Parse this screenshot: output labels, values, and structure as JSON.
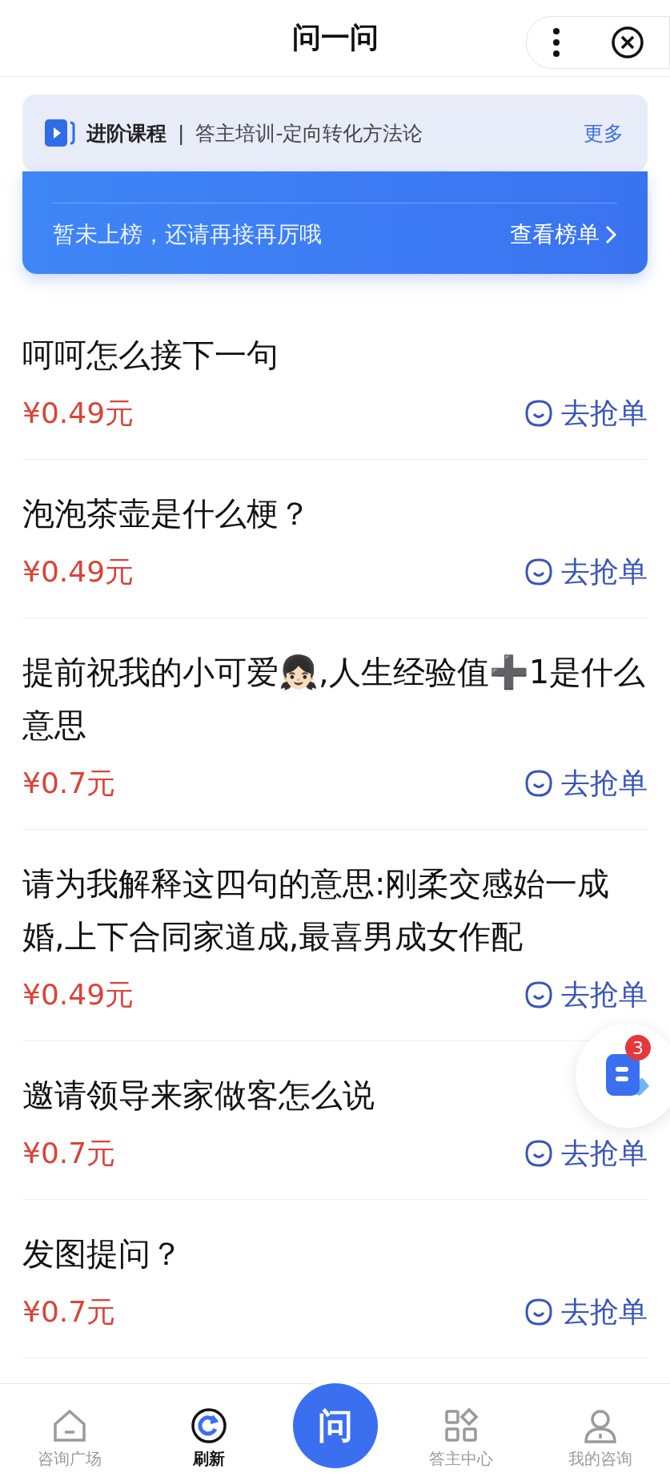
{
  "header": {
    "title": "问一问"
  },
  "course_bar": {
    "tag": "进阶课程",
    "separator": "|",
    "title": "答主培训-定向转化方法论",
    "more": "更多"
  },
  "rank_banner": {
    "message": "暂未上榜，还请再接再厉哦",
    "link": "查看榜单"
  },
  "questions": [
    {
      "text": "呵呵怎么接下一句",
      "price": "¥0.49元",
      "action": "去抢单"
    },
    {
      "text": "泡泡茶壶是什么梗？",
      "price": "¥0.49元",
      "action": "去抢单"
    },
    {
      "text": "提前祝我的小可爱👧🏻,人生经验值➕1是什么意思",
      "price": "¥0.7元",
      "action": "去抢单"
    },
    {
      "text": "请为我解释这四句的意思:刚柔交感始一成婚,上下合同家道成,最喜男成女作配",
      "price": "¥0.49元",
      "action": "去抢单"
    },
    {
      "text": "邀请领导来家做客怎么说",
      "price": "¥0.7元",
      "action": "去抢单"
    },
    {
      "text": "发图提问？",
      "price": "¥0.7元",
      "action": "去抢单"
    }
  ],
  "float_button": {
    "badge": "3"
  },
  "nav": [
    {
      "kind": "home",
      "label": "咨询广场",
      "selected": false
    },
    {
      "kind": "refresh",
      "label": "刷新",
      "selected": true
    },
    {
      "kind": "ask",
      "label": "问",
      "selected": false
    },
    {
      "kind": "grid",
      "label": "答主中心",
      "selected": false
    },
    {
      "kind": "person",
      "label": "我的咨询",
      "selected": false
    }
  ]
}
